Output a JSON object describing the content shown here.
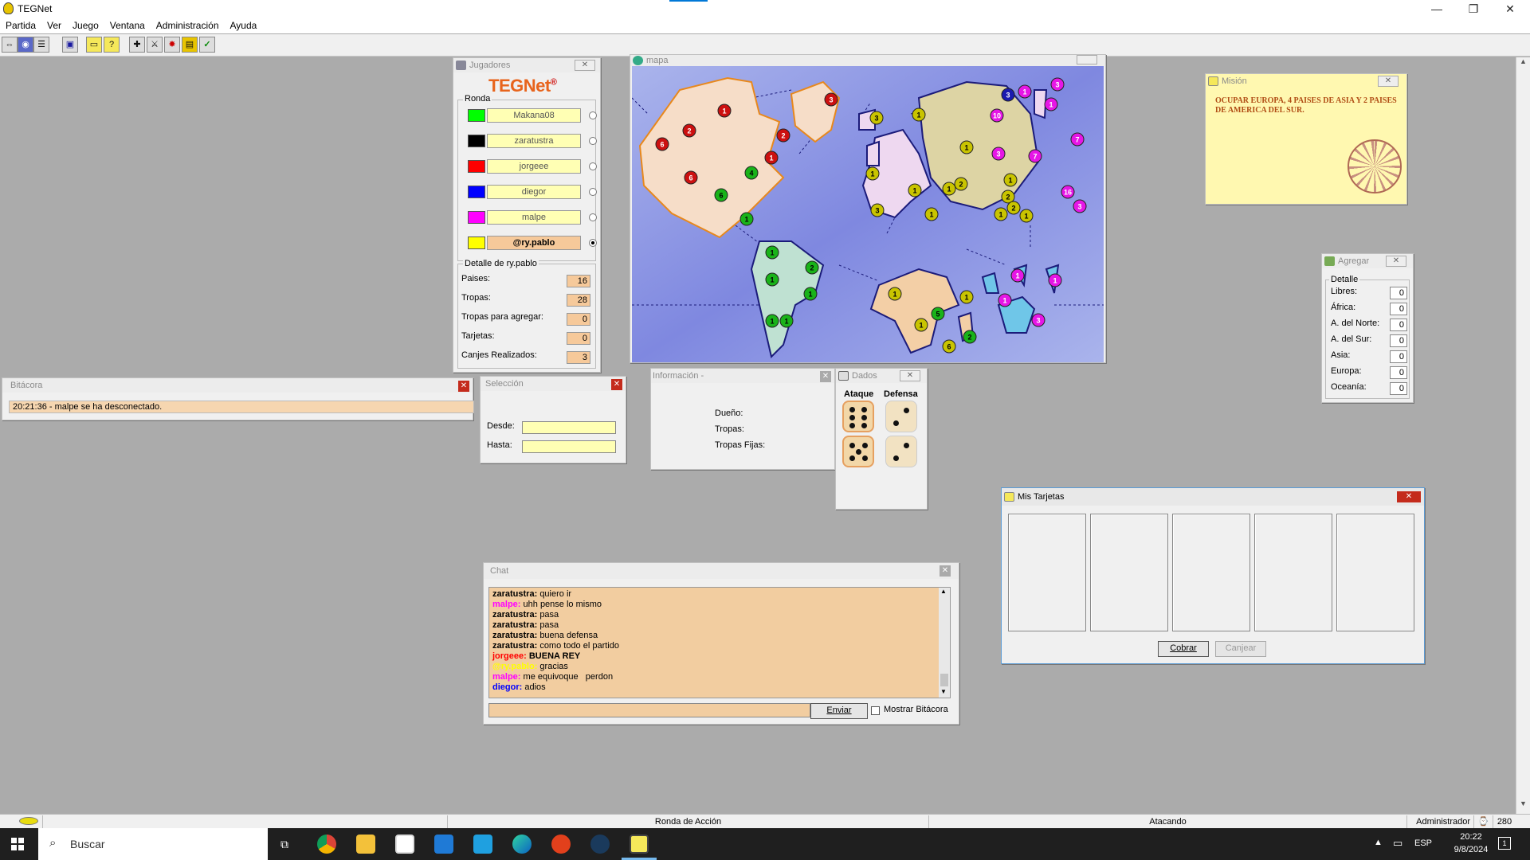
{
  "app": {
    "title": "TEGNet"
  },
  "menu": [
    "Partida",
    "Ver",
    "Juego",
    "Ventana",
    "Administración",
    "Ayuda"
  ],
  "window_controls": {
    "minimize": "—",
    "restore": "❐",
    "close": "✕"
  },
  "jugadores": {
    "title": "Jugadores",
    "logo": "TEGNet",
    "logo_mark": "®",
    "round_label": "Ronda",
    "players": [
      {
        "name": "Makana08",
        "color": "#00ff00",
        "active": false
      },
      {
        "name": "zaratustra",
        "color": "#000000",
        "active": false
      },
      {
        "name": "jorgeee",
        "color": "#ff0000",
        "active": false
      },
      {
        "name": "diegor",
        "color": "#0000ff",
        "active": false
      },
      {
        "name": "malpe",
        "color": "#ff00ff",
        "active": false
      },
      {
        "name": "@ry.pablo",
        "color": "#ffff00",
        "active": true
      }
    ],
    "detail_title": "Detalle de ry.pablo",
    "detail": [
      {
        "label": "Paises:",
        "value": "16"
      },
      {
        "label": "Tropas:",
        "value": "28"
      },
      {
        "label": "Tropas para agregar:",
        "value": "0"
      },
      {
        "label": "Tarjetas:",
        "value": "0"
      },
      {
        "label": "Canjes Realizados:",
        "value": "3"
      }
    ]
  },
  "mapa": {
    "title": "mapa"
  },
  "mision": {
    "title": "Misión",
    "text": "OCUPAR EUROPA, 4 PAISES DE ASIA Y 2 PAISES DE AMERICA DEL SUR."
  },
  "agregar": {
    "title": "Agregar",
    "group": "Detalle",
    "rows": [
      {
        "label": "Libres:",
        "value": "0"
      },
      {
        "label": "África:",
        "value": "0"
      },
      {
        "label": "A. del Norte:",
        "value": "0"
      },
      {
        "label": "A. del Sur:",
        "value": "0"
      },
      {
        "label": "Asia:",
        "value": "0"
      },
      {
        "label": "Europa:",
        "value": "0"
      },
      {
        "label": "Oceanía:",
        "value": "0"
      }
    ]
  },
  "bitacora": {
    "title": "Bitácora",
    "entry": "20:21:36 - malpe se ha desconectado."
  },
  "seleccion": {
    "title": "Selección",
    "desde_label": "Desde:",
    "hasta_label": "Hasta:",
    "desde": "",
    "hasta": ""
  },
  "informacion": {
    "title": "Información -",
    "dueno": "Dueño:",
    "tropas": "Tropas:",
    "fijas": "Tropas Fijas:"
  },
  "dados": {
    "title": "Dados",
    "attack_label": "Ataque",
    "defense_label": "Defensa",
    "attack": [
      6,
      5
    ],
    "defense": [
      2,
      2
    ]
  },
  "tarjetas": {
    "title": "Mis Tarjetas",
    "cobrar": "Cobrar",
    "canjear": "Canjear"
  },
  "chat": {
    "title": "Chat",
    "messages": [
      {
        "who": "zaratustra:",
        "text": "quiero ir",
        "color": "#000000"
      },
      {
        "who": "malpe:",
        "text": "uhh pense lo mismo",
        "color": "#ff00ff"
      },
      {
        "who": "zaratustra:",
        "text": "pasa",
        "color": "#000000"
      },
      {
        "who": "zaratustra:",
        "text": "pasa",
        "color": "#000000"
      },
      {
        "who": "zaratustra:",
        "text": "buena defensa",
        "color": "#000000"
      },
      {
        "who": "zaratustra:",
        "text": "como todo el partido",
        "color": "#000000"
      },
      {
        "who": "jorgeee:",
        "text": "BUENA REY",
        "color": "#ff0000"
      },
      {
        "who": "@ry.pablo:",
        "text": "gracias",
        "color": "#ffff00"
      },
      {
        "who": "malpe:",
        "text": "me equivoque   perdon",
        "color": "#ff00ff"
      },
      {
        "who": "diegor:",
        "text": "adios",
        "color": "#0000ff"
      }
    ],
    "input": "",
    "send": "Enviar",
    "show_log": "Mostrar Bitácora"
  },
  "status": {
    "phase": "Ronda de Acción",
    "state": "Atacando",
    "user": "Administrador",
    "num": "280"
  },
  "taskbar": {
    "search": "Buscar",
    "lang": "ESP",
    "time": "20:22",
    "date": "9/8/2024",
    "notif": "1"
  },
  "territories": [
    {
      "v": "1",
      "c": "red"
    },
    {
      "v": "2",
      "c": "red"
    },
    {
      "v": "6",
      "c": "red"
    },
    {
      "v": "2",
      "c": "red"
    },
    {
      "v": "1",
      "c": "red"
    },
    {
      "v": "6",
      "c": "red"
    },
    {
      "v": "3",
      "c": "red"
    },
    {
      "v": "4",
      "c": "green"
    },
    {
      "v": "6",
      "c": "green"
    },
    {
      "v": "1",
      "c": "green"
    },
    {
      "v": "1",
      "c": "green"
    },
    {
      "v": "2",
      "c": "green"
    },
    {
      "v": "1",
      "c": "green"
    },
    {
      "v": "1",
      "c": "green"
    },
    {
      "v": "1",
      "c": "green"
    },
    {
      "v": "1",
      "c": "green"
    },
    {
      "v": "3",
      "c": "yellow"
    },
    {
      "v": "1",
      "c": "yellow"
    },
    {
      "v": "1",
      "c": "yellow"
    },
    {
      "v": "1",
      "c": "yellow"
    },
    {
      "v": "2",
      "c": "yellow"
    },
    {
      "v": "1",
      "c": "yellow"
    },
    {
      "v": "1",
      "c": "yellow"
    },
    {
      "v": "3",
      "c": "yellow"
    },
    {
      "v": "1",
      "c": "yellow"
    },
    {
      "v": "3",
      "c": "blue"
    },
    {
      "v": "1",
      "c": "magenta"
    },
    {
      "v": "3",
      "c": "magenta"
    },
    {
      "v": "1",
      "c": "magenta"
    },
    {
      "v": "10",
      "c": "magenta"
    },
    {
      "v": "3",
      "c": "magenta"
    },
    {
      "v": "7",
      "c": "magenta"
    },
    {
      "v": "7",
      "c": "magenta"
    },
    {
      "v": "1",
      "c": "yellow"
    },
    {
      "v": "2",
      "c": "yellow"
    },
    {
      "v": "2",
      "c": "yellow"
    },
    {
      "v": "1",
      "c": "yellow"
    },
    {
      "v": "1",
      "c": "yellow"
    },
    {
      "v": "16",
      "c": "magenta"
    },
    {
      "v": "3",
      "c": "magenta"
    },
    {
      "v": "1",
      "c": "yellow"
    },
    {
      "v": "1",
      "c": "yellow"
    },
    {
      "v": "5",
      "c": "green"
    },
    {
      "v": "1",
      "c": "yellow"
    },
    {
      "v": "2",
      "c": "green"
    },
    {
      "v": "6",
      "c": "yellow"
    },
    {
      "v": "1",
      "c": "magenta"
    },
    {
      "v": "1",
      "c": "magenta"
    },
    {
      "v": "1",
      "c": "magenta"
    },
    {
      "v": "3",
      "c": "magenta"
    }
  ]
}
